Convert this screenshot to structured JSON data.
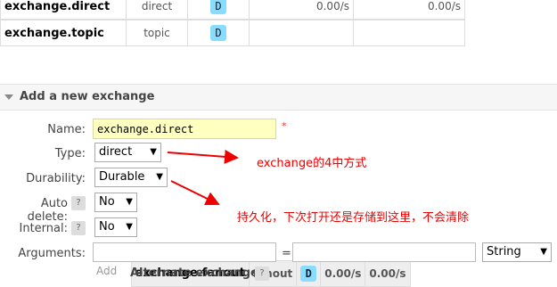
{
  "exchanges": [
    {
      "name": "exchange.direct",
      "type": "direct",
      "feature": "D",
      "rate_in": "0.00/s",
      "rate_out": "0.00/s"
    },
    {
      "name": "exchange.fanout",
      "type": "fanout",
      "feature": "D",
      "rate_in": "0.00/s",
      "rate_out": "0.00/s"
    },
    {
      "name": "exchange.topic",
      "type": "topic",
      "feature": "D",
      "rate_in": "",
      "rate_out": ""
    }
  ],
  "section": {
    "title": "Add a new exchange"
  },
  "form": {
    "name_label": "Name:",
    "name_value": "exchange.direct",
    "required_mark": "*",
    "type_label": "Type:",
    "type_value": "direct",
    "durability_label": "Durability:",
    "durability_value": "Durable",
    "auto_delete_label": "Auto delete:",
    "auto_delete_value": "No",
    "internal_label": "Internal:",
    "internal_value": "No",
    "arguments_label": "Arguments:",
    "equals": "=",
    "arg_type_value": "String",
    "help": "?",
    "add_label": "Add",
    "alternate_label": "Alternate exchange"
  },
  "annotations": {
    "type_note": "exchange的4中方式",
    "durability_note": "持久化，下次打开还是存储到这里，不会清除"
  },
  "colors": {
    "annotation": "#e00000",
    "feature_badge": "#88ddff",
    "name_field": "#ffffc0"
  }
}
